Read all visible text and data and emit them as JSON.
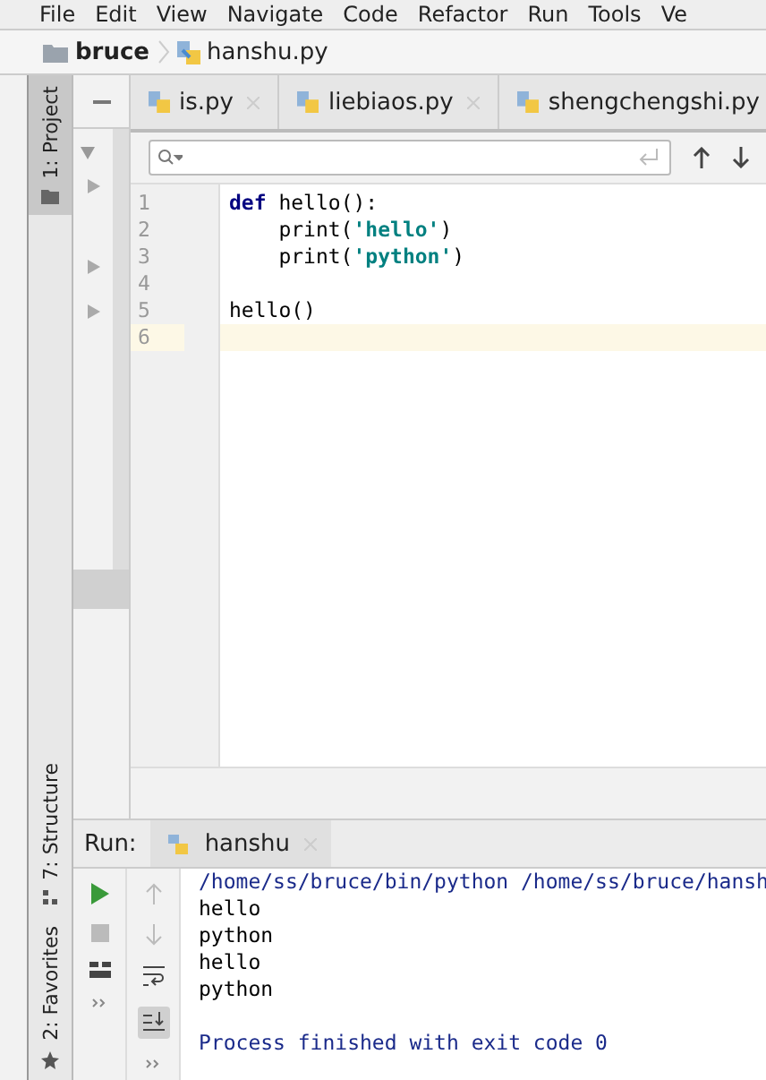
{
  "menu": [
    "File",
    "Edit",
    "View",
    "Navigate",
    "Code",
    "Refactor",
    "Run",
    "Tools",
    "Ve"
  ],
  "breadcrumb": {
    "folder": "bruce",
    "file": "hanshu.py"
  },
  "tool_stripe": {
    "top": [
      {
        "label": "1: Project",
        "selected": true
      }
    ],
    "bottom": [
      {
        "label": "7: Structure",
        "selected": false
      },
      {
        "label": "2: Favorites",
        "selected": false
      }
    ]
  },
  "tabs": [
    {
      "label": "is.py",
      "selected": false
    },
    {
      "label": "liebiaos.py",
      "selected": false
    },
    {
      "label": "shengchengshi.py",
      "selected": false
    }
  ],
  "code": [
    {
      "number": "1",
      "current": false,
      "tokens": [
        {
          "kind": "keyword",
          "text": "def"
        },
        {
          "kind": "plain",
          "text": " hello():"
        }
      ]
    },
    {
      "number": "2",
      "current": false,
      "tokens": [
        {
          "kind": "plain",
          "text": "    print("
        },
        {
          "kind": "string",
          "text": "'hello'"
        },
        {
          "kind": "plain",
          "text": ")"
        }
      ]
    },
    {
      "number": "3",
      "current": false,
      "tokens": [
        {
          "kind": "plain",
          "text": "    print("
        },
        {
          "kind": "string",
          "text": "'python'"
        },
        {
          "kind": "plain",
          "text": ")"
        }
      ]
    },
    {
      "number": "4",
      "current": false
    },
    {
      "number": "5",
      "current": false,
      "tokens": [
        {
          "kind": "plain",
          "text": "hello()"
        }
      ]
    },
    {
      "number": "6",
      "current": true
    }
  ],
  "run": {
    "label": "Run:",
    "tab": "hanshu",
    "output": [
      {
        "kind": "command",
        "text": "/home/ss/bruce/bin/python /home/ss/bruce/hansh"
      },
      {
        "kind": "stdout",
        "text": "hello"
      },
      {
        "kind": "stdout",
        "text": "python"
      },
      {
        "kind": "stdout",
        "text": "hello"
      },
      {
        "kind": "stdout",
        "text": "python"
      },
      {
        "kind": "system",
        "text": "Process finished with exit code 0"
      }
    ]
  }
}
